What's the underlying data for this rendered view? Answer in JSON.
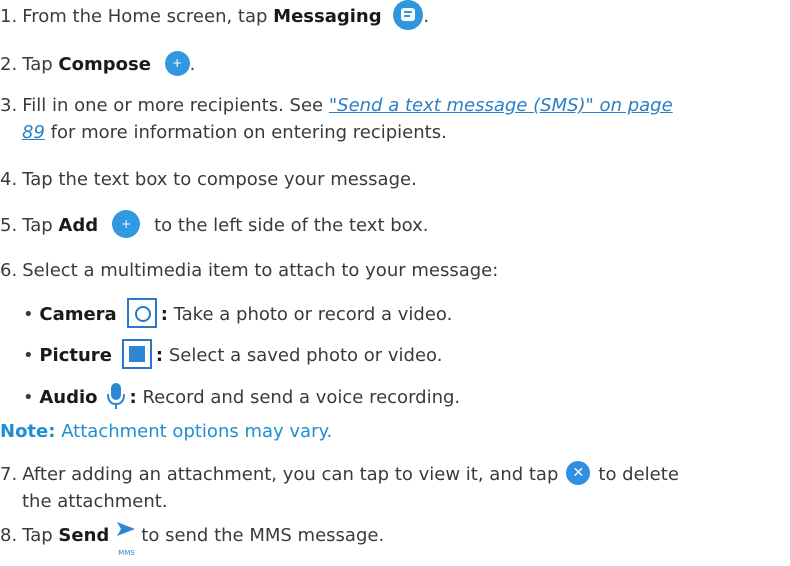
{
  "steps": [
    {
      "num": "1.",
      "pre": "From the Home screen, tap",
      "bold": "Messaging",
      "post": "."
    },
    {
      "num": "2.",
      "pre": "Tap",
      "bold": "Compose",
      "post": "."
    },
    {
      "num": "3.",
      "pre": "Fill in one or more recipients. See",
      "link": "\"Send a text message (SMS)\" on page",
      "link2": "89",
      "post": "for more information on entering recipients."
    },
    {
      "num": "4.",
      "text": "Tap the text box to compose your message."
    },
    {
      "num": "5.",
      "pre": "Tap",
      "bold": "Add",
      "post": "to the left side of the text box."
    },
    {
      "num": "6.",
      "text": "Select a multimedia item to attach to your message:"
    },
    {
      "num": "7.",
      "pre": "After adding an attachment, you can tap to view it, and tap",
      "post": "to delete",
      "cont": "the attachment."
    },
    {
      "num": "8.",
      "pre": "Tap",
      "bold": "Send",
      "post": "to send the MMS message."
    }
  ],
  "bullets": [
    {
      "bold": "Camera",
      "text": "Take a photo or record a video.",
      "icon": "camera-icon"
    },
    {
      "bold": "Picture",
      "text": "Select a saved photo or video.",
      "icon": "picture-icon"
    },
    {
      "bold": "Audio",
      "text": "Record and send a voice recording.",
      "icon": "microphone-icon"
    }
  ],
  "bullet_mark": "•",
  "colon": ":",
  "note": {
    "label": "Note:",
    "text": "Attachment options may vary."
  },
  "icon_labels": {
    "plus": "+",
    "close": "✕",
    "mms": "MMS"
  },
  "colors": {
    "accent": "#2d96dd",
    "note": "#1e8fd0",
    "link": "#2a7fc5"
  }
}
